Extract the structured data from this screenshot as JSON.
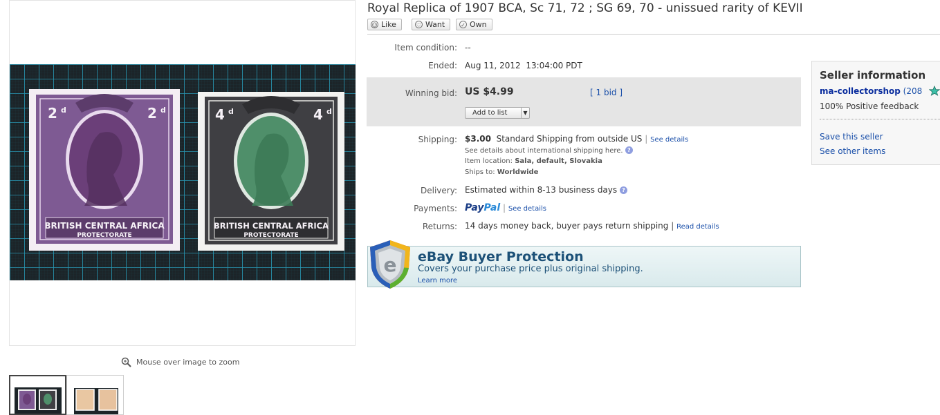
{
  "title": "Royal Replica of 1907 BCA, Sc 71, 72 ; SG 69, 70 - unissued rarity of KEVII",
  "social": {
    "like": "Like",
    "want": "Want",
    "own": "Own"
  },
  "image": {
    "stamp1": {
      "value_left": "2",
      "value_right": "2",
      "suffix": "d",
      "line1": "BRITISH CENTRAL AFRICA",
      "line2": "PROTECTORATE",
      "frame_color": "#7e5a93",
      "center_color": "#6b3f79"
    },
    "stamp2": {
      "value_left": "4",
      "value_right": "4",
      "suffix": "d",
      "line1": "BRITISH CENTRAL AFRICA",
      "line2": "PROTECTORATE",
      "frame_color": "#3f3f43",
      "center_color": "#4f8f6a"
    },
    "zoom_hint": "Mouse over image to zoom"
  },
  "details": {
    "condition_label": "Item condition:",
    "condition_value": "--",
    "ended_label": "Ended:",
    "ended_date": "Aug 11, 2012",
    "ended_time": "13:04:00 PDT",
    "bid_label": "Winning bid:",
    "bid_amount": "US $4.99",
    "bid_count": "[ 1 bid ]",
    "add_to_list": "Add to list",
    "shipping_label": "Shipping:",
    "shipping_cost": "$3.00",
    "shipping_method": "Standard Shipping from outside US",
    "see_details": "See details",
    "intl_shipping": "See details about international shipping here.",
    "location_label": "Item location:",
    "location_value": "Sala, default, Slovakia",
    "ships_label": "Ships to:",
    "ships_value": "Worldwide",
    "delivery_label": "Delivery:",
    "delivery_value": "Estimated within 8-13 business days",
    "payments_label": "Payments:",
    "paypal_a": "Pay",
    "paypal_b": "Pal",
    "payments_link": "See details",
    "returns_label": "Returns:",
    "returns_value": "14 days money back, buyer pays return shipping",
    "returns_link": "Read details"
  },
  "protection": {
    "title": "eBay Buyer Protection",
    "subtitle": "Covers your purchase price plus original shipping.",
    "learn_more": "Learn more",
    "shield_letter": "e"
  },
  "seller": {
    "heading": "Seller information",
    "name": "ma-collectorshop",
    "score_prefix": "(208",
    "score_suffix": ")",
    "feedback": "100% Positive feedback",
    "save_seller": "Save this seller",
    "other_items": "See other items",
    "star_color": "#3cc0a8"
  }
}
